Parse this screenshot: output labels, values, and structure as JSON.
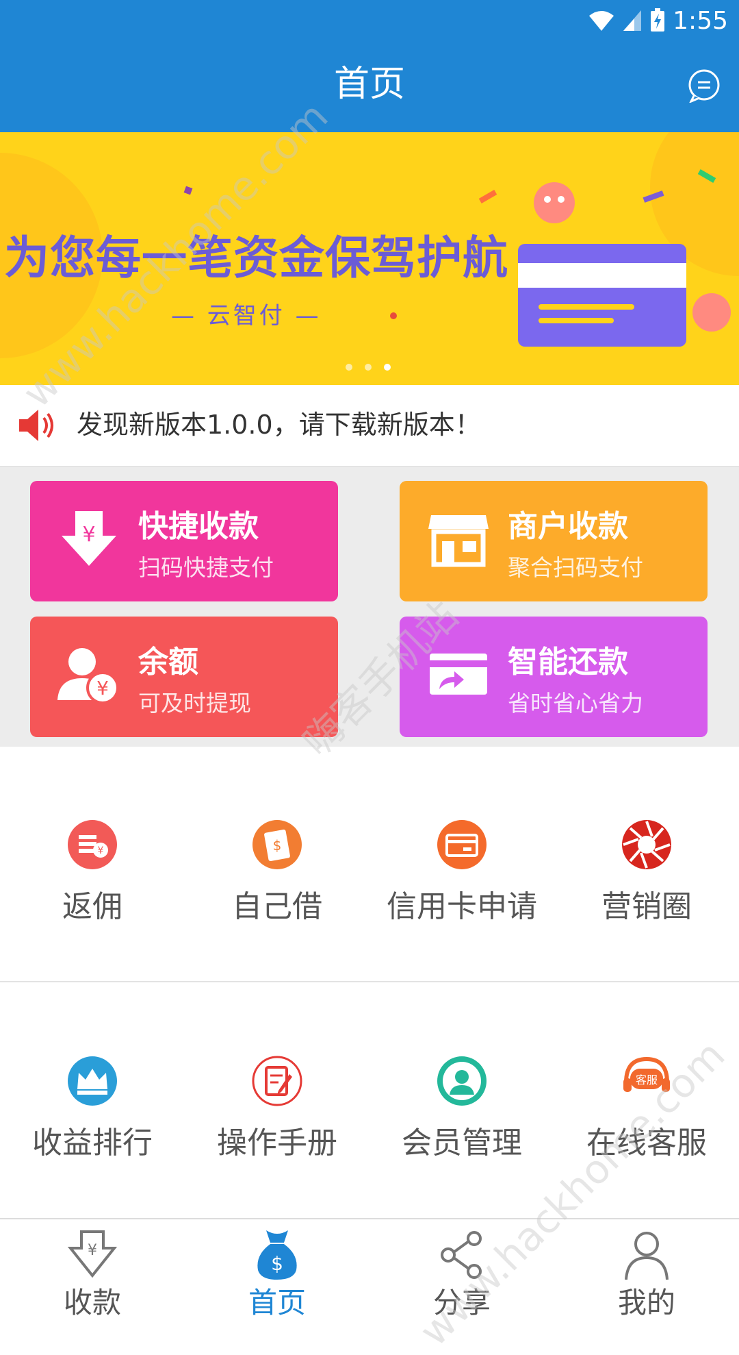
{
  "status_bar": {
    "time": "1:55"
  },
  "header": {
    "title": "首页",
    "message_icon": "chat-bubble-icon",
    "color": "#1f86d4"
  },
  "banner": {
    "slogan": "为您每一笔资金保驾护航",
    "subtitle": "— 云智付 —",
    "dots": 3,
    "active_dot": 2
  },
  "notice": {
    "text": "发现新版本1.0.0，请下载新版本！",
    "icon": "speaker-icon"
  },
  "tiles": [
    {
      "title": "快捷收款",
      "subtitle": "扫码快捷支付",
      "icon": "download-yen-icon",
      "color": "#f1369c"
    },
    {
      "title": "商户收款",
      "subtitle": "聚合扫码支付",
      "icon": "storefront-icon",
      "color": "#fdab2a"
    },
    {
      "title": "余额",
      "subtitle": "可及时提现",
      "icon": "user-yen-icon",
      "color": "#f55658"
    },
    {
      "title": "智能还款",
      "subtitle": "省时省心省力",
      "icon": "card-repay-icon",
      "color": "#d65bec"
    }
  ],
  "menu_row1": [
    {
      "label": "返佣",
      "icon": "rebate-icon",
      "color": "#f25a57"
    },
    {
      "label": "自己借",
      "icon": "borrow-icon",
      "color": "#f27d32"
    },
    {
      "label": "信用卡申请",
      "icon": "credit-card-icon",
      "color": "#f46a2b"
    },
    {
      "label": "营销圈",
      "icon": "aperture-icon",
      "color": "#d7261e"
    }
  ],
  "menu_row2": [
    {
      "label": "收益排行",
      "icon": "crown-icon",
      "color": "#2a9ed8"
    },
    {
      "label": "操作手册",
      "icon": "manual-icon",
      "color": "#e53a35"
    },
    {
      "label": "会员管理",
      "icon": "member-icon",
      "color": "#23b89a"
    },
    {
      "label": "在线客服",
      "icon": "customer-service-icon",
      "color": "#f2692d",
      "badge": "客服"
    }
  ],
  "bottom_nav": [
    {
      "label": "收款",
      "icon": "receive-yen-icon",
      "active": false
    },
    {
      "label": "首页",
      "icon": "money-bag-icon",
      "active": true
    },
    {
      "label": "分享",
      "icon": "share-icon",
      "active": false
    },
    {
      "label": "我的",
      "icon": "person-icon",
      "active": false
    }
  ],
  "watermark": {
    "text1": "www.hackhome.com",
    "text2": "嗨客手机站"
  }
}
